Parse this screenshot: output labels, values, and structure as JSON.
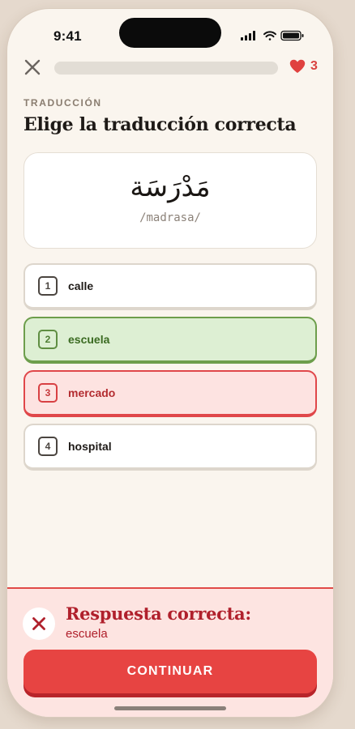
{
  "status_bar": {
    "time": "9:41"
  },
  "top_bar": {
    "progress_fraction": 0.0,
    "hearts_count": "3"
  },
  "question": {
    "eyebrow": "TRADUCCIÓN",
    "title": "Elige la traducción correcta",
    "word": "مَدْرَسَة",
    "transliteration": "/madrasa/"
  },
  "options": [
    {
      "number": "1",
      "text": "calle",
      "state": "neutral"
    },
    {
      "number": "2",
      "text": "escuela",
      "state": "correct"
    },
    {
      "number": "3",
      "text": "mercado",
      "state": "wrong"
    },
    {
      "number": "4",
      "text": "hospital",
      "state": "neutral"
    }
  ],
  "feedback": {
    "title": "Respuesta correcta:",
    "answer": "escuela",
    "button_label": "CONTINUAR"
  },
  "colors": {
    "correct": "#6d9e4c",
    "wrong": "#e04a47",
    "background": "#faf5ee",
    "button": "#e74442"
  },
  "icons": [
    "close-icon",
    "heart-icon",
    "signal-icon",
    "wifi-icon",
    "battery-icon",
    "x-icon"
  ]
}
